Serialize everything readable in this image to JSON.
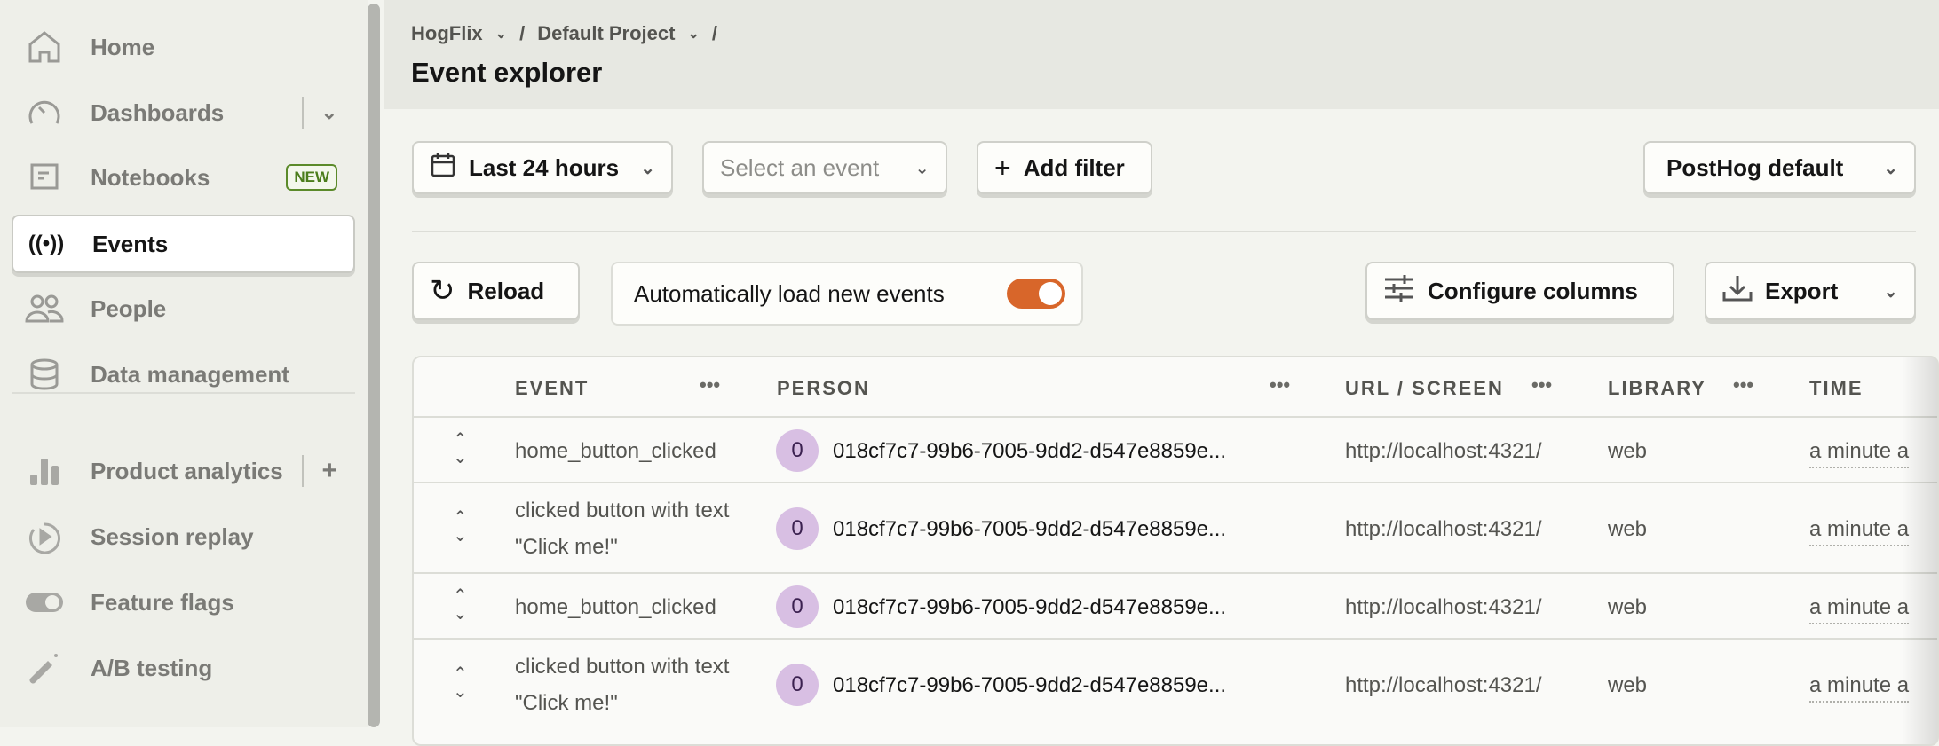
{
  "sidebar": {
    "items": [
      {
        "label": "Home",
        "icon": "home-icon"
      },
      {
        "label": "Dashboards",
        "icon": "dashboard-icon"
      },
      {
        "label": "Notebooks",
        "icon": "notebook-icon",
        "badge": "NEW"
      },
      {
        "label": "Events",
        "icon": "events-icon",
        "active": true
      },
      {
        "label": "People",
        "icon": "people-icon"
      },
      {
        "label": "Data management",
        "icon": "database-icon"
      },
      {
        "label": "Product analytics",
        "icon": "bar-chart-icon"
      },
      {
        "label": "Session replay",
        "icon": "replay-icon"
      },
      {
        "label": "Feature flags",
        "icon": "toggle-icon"
      },
      {
        "label": "A/B testing",
        "icon": "flask-icon"
      }
    ]
  },
  "header": {
    "breadcrumb": [
      "HogFlix",
      "Default Project"
    ],
    "title": "Event explorer"
  },
  "filters": {
    "date": "Last 24 hours",
    "event_placeholder": "Select an event",
    "add_filter": "Add filter",
    "columns_preset": "PostHog default"
  },
  "toolbar": {
    "reload": "Reload",
    "auto_load": "Automatically load new events",
    "auto_load_on": true,
    "configure": "Configure columns",
    "export": "Export",
    "accent": "#d8662a"
  },
  "table": {
    "columns": [
      "EVENT",
      "PERSON",
      "URL / SCREEN",
      "LIBRARY",
      "TIME"
    ],
    "rows": [
      {
        "event": "home_button_clicked",
        "avatar": "0",
        "person": "018cf7c7-99b6-7005-9dd2-d547e8859e...",
        "url": "http://localhost:4321/",
        "library": "web",
        "time": "a minute a"
      },
      {
        "event": "clicked button with text \"Click me!\"",
        "avatar": "0",
        "person": "018cf7c7-99b6-7005-9dd2-d547e8859e...",
        "url": "http://localhost:4321/",
        "library": "web",
        "time": "a minute a"
      },
      {
        "event": "home_button_clicked",
        "avatar": "0",
        "person": "018cf7c7-99b6-7005-9dd2-d547e8859e...",
        "url": "http://localhost:4321/",
        "library": "web",
        "time": "a minute a"
      },
      {
        "event": "clicked button with text \"Click me!\"",
        "avatar": "0",
        "person": "018cf7c7-99b6-7005-9dd2-d547e8859e...",
        "url": "http://localhost:4321/",
        "library": "web",
        "time": "a minute a"
      }
    ]
  }
}
